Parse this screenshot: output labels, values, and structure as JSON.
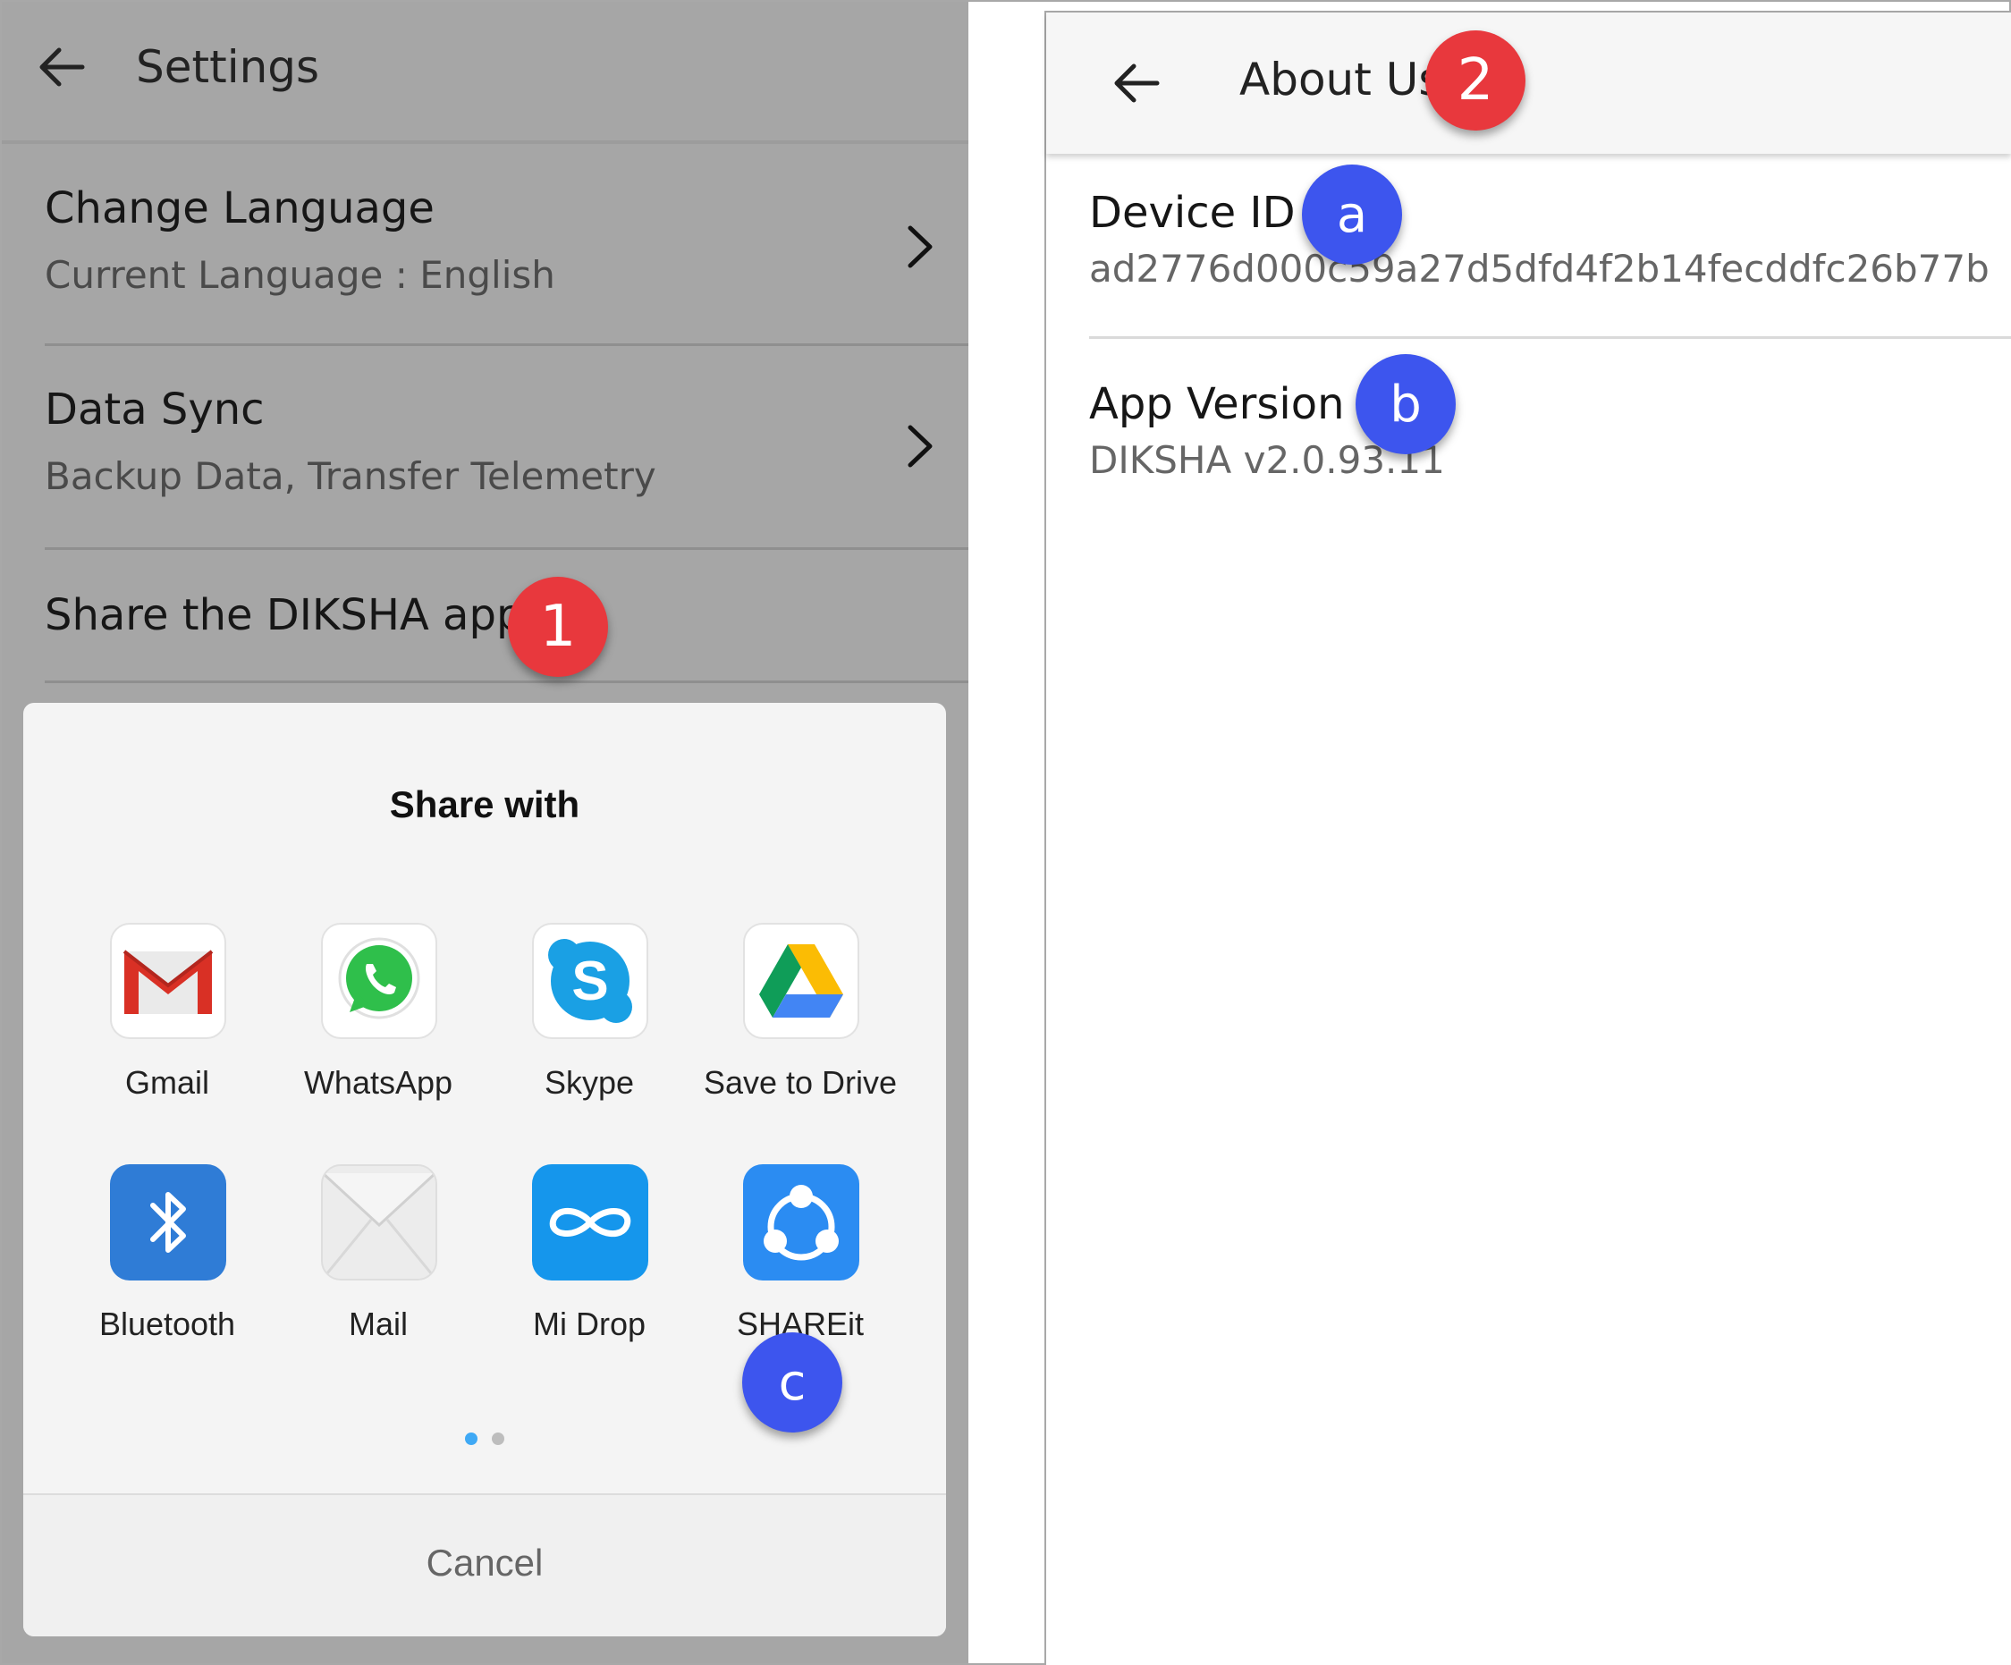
{
  "settings": {
    "title": "Settings",
    "items": [
      {
        "title": "Change Language",
        "subtitle": "Current Language : English"
      },
      {
        "title": "Data Sync",
        "subtitle": "Backup Data, Transfer Telemetry"
      },
      {
        "title": "Share the DIKSHA app"
      }
    ]
  },
  "share_sheet": {
    "title": "Share with",
    "apps": [
      {
        "label": "Gmail",
        "icon": "gmail-icon"
      },
      {
        "label": "WhatsApp",
        "icon": "whatsapp-icon"
      },
      {
        "label": "Skype",
        "icon": "skype-icon"
      },
      {
        "label": "Save to Drive",
        "icon": "google-drive-icon"
      },
      {
        "label": "Bluetooth",
        "icon": "bluetooth-icon"
      },
      {
        "label": "Mail",
        "icon": "mail-icon"
      },
      {
        "label": "Mi Drop",
        "icon": "mi-drop-icon"
      },
      {
        "label": "SHAREit",
        "icon": "shareit-icon"
      }
    ],
    "page_indicator": {
      "pages": 2,
      "current": 1
    },
    "cancel_label": "Cancel"
  },
  "about": {
    "title": "About Us",
    "device_id_label": "Device ID",
    "device_id_value": "ad2776d000c59a27d5dfd4f2b14fecddfc26b77b",
    "app_version_label": "App Version",
    "app_version_value": "DIKSHA v2.0.93.11"
  },
  "callouts": {
    "one": "1",
    "two": "2",
    "a": "a",
    "b": "b",
    "c": "c"
  },
  "colors": {
    "callout_red": "#e8383d",
    "callout_blue": "#3d55ee",
    "overlay_gray": "#a6a6a6",
    "page_dot_active": "#3fa9f5"
  }
}
